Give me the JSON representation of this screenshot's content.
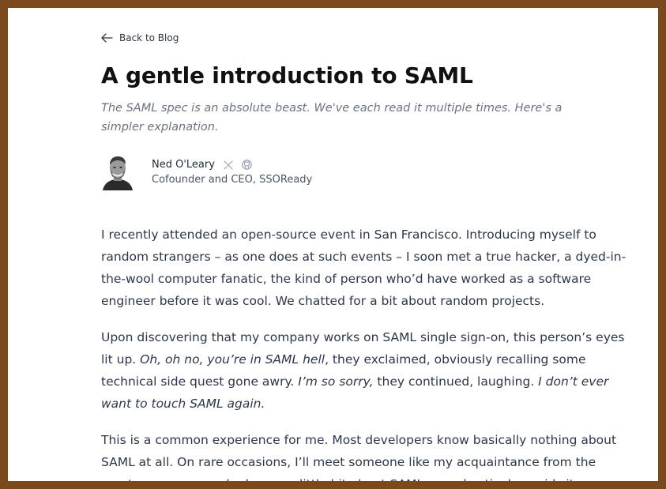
{
  "nav": {
    "back_label": "Back to Blog"
  },
  "article": {
    "title": "A gentle introduction to SAML",
    "subtitle": "The SAML spec is an absolute beast. We've each read it multiple times. Here's a simpler explanation."
  },
  "author": {
    "name": "Ned O'Leary",
    "role": "Cofounder and CEO, SSOReady",
    "social_icons": [
      "x-icon",
      "github-icon"
    ]
  },
  "paragraphs": {
    "p1": "I recently attended an open-source event in San Francisco. Introducing myself to random strangers – as one does at such events – I soon met a true hacker, a dyed-in-the-wool computer fanatic, the kind of person who’d have worked as a software engineer before it was cool. We chatted for a bit about random projects.",
    "p2_a": "Upon discovering that my company works on SAML single sign-on, this person’s eyes lit up. ",
    "p2_em1": "Oh, oh no, you’re in SAML hell",
    "p2_b": ", they exclaimed, obviously recalling some technical side quest gone awry. ",
    "p2_em2": "I’m so sorry,",
    "p2_c": " they continued, laughing. ",
    "p2_em3": "I don’t ever want to touch SAML again.",
    "p3": "This is a common experience for me. Most developers know basically nothing about SAML at all. On rare occasions, I’ll meet someone like my acquaintance from the meetup, someone who knows a little bit about SAML … and actively avoids it."
  },
  "colors": {
    "border": "#7a4a1e",
    "background": "#ffffff",
    "title": "#111111",
    "subtitle": "#6b7280",
    "body": "#2d3748"
  }
}
